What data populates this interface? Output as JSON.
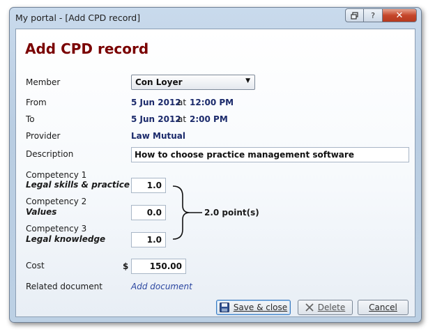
{
  "window": {
    "title": "My portal - [Add CPD record]",
    "help_glyph": "?",
    "close_glyph": "✕"
  },
  "form": {
    "heading": "Add CPD record",
    "member": {
      "label": "Member",
      "value": "Con Loyer"
    },
    "from": {
      "label": "From",
      "date": "5 Jun 2012",
      "at": "at",
      "time": "12:00 PM"
    },
    "to": {
      "label": "To",
      "date": "5 Jun 2012",
      "at": "at",
      "time": "2:00 PM"
    },
    "provider": {
      "label": "Provider",
      "value": "Law Mutual"
    },
    "description": {
      "label": "Description",
      "value": "How to choose practice management software"
    },
    "competencies": [
      {
        "label": "Competency 1",
        "name": "Legal skills & practice",
        "value": "1.0"
      },
      {
        "label": "Competency 2",
        "name": "Values",
        "value": "0.0"
      },
      {
        "label": "Competency 3",
        "name": "Legal knowledge",
        "value": "1.0"
      }
    ],
    "total_points": "2.0 point(s)",
    "cost": {
      "label": "Cost",
      "currency": "$",
      "value": "150.00"
    },
    "related_document": {
      "label": "Related document",
      "link": "Add document"
    }
  },
  "buttons": {
    "save_close": "Save & close",
    "delete": "Delete",
    "cancel": "Cancel"
  },
  "icons": {
    "restore": "restore-icon",
    "help": "help-icon",
    "close": "close-icon",
    "dropdown": "chevron-down-icon",
    "save": "floppy-disk-icon",
    "delete": "x-icon"
  },
  "colors": {
    "heading": "#7a0000",
    "value_text": "#1b2a6b",
    "link": "#2b46a0",
    "close_button": "#c5472a"
  }
}
